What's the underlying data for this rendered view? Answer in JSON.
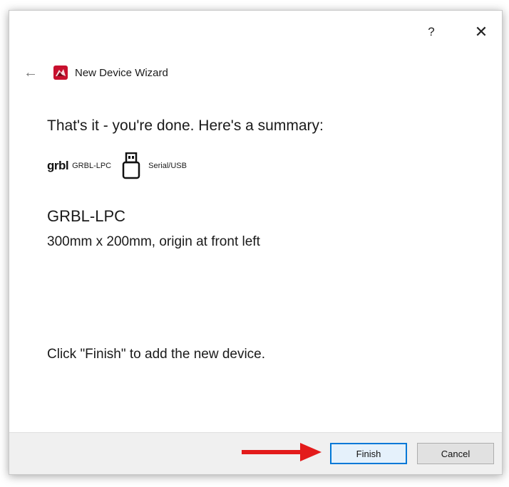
{
  "titlebar": {
    "help_glyph": "?",
    "close_glyph": "✕"
  },
  "header": {
    "back_glyph": "←",
    "title": "New Device Wizard"
  },
  "summary": {
    "heading": "That's it - you're done.  Here's a summary:",
    "controller_logo": "grbl",
    "controller_label": "GRBL-LPC",
    "connection_label": "Serial/USB",
    "device_name": "GRBL-LPC",
    "device_details": "300mm x 200mm, origin at front left",
    "finish_hint": "Click \"Finish\" to add the new device."
  },
  "footer": {
    "finish_label": "Finish",
    "cancel_label": "Cancel"
  },
  "colors": {
    "accent": "#0078d7",
    "arrow": "#e31b1b",
    "app_icon": "#c8102e"
  },
  "icons": {
    "help": "question-icon",
    "close": "close-icon",
    "back": "back-arrow-icon",
    "app": "lightburn-app-icon",
    "usb": "usb-drive-icon",
    "pointer": "red-arrow-icon"
  }
}
